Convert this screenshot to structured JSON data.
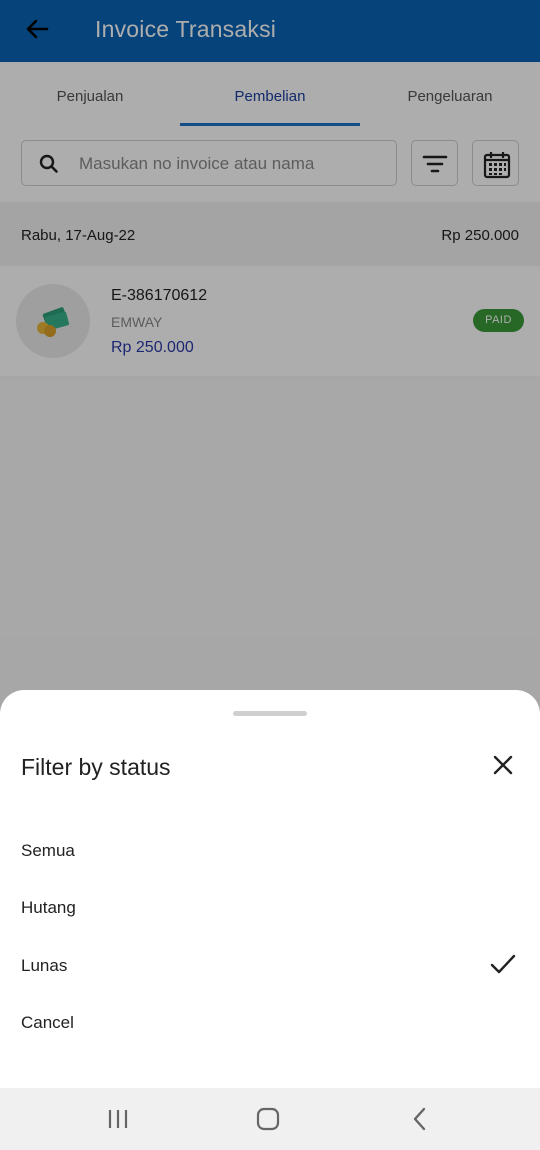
{
  "appbar": {
    "title": "Invoice Transaksi",
    "back_icon": "arrow-left-icon"
  },
  "tabs": [
    {
      "label": "Penjualan"
    },
    {
      "label": "Pembelian",
      "active": true
    },
    {
      "label": "Pengeluaran"
    }
  ],
  "search": {
    "placeholder": "Masukan no invoice atau nama",
    "icon": "search-icon"
  },
  "toolbar": {
    "filter_icon": "filter-icon",
    "calendar_icon": "calendar-icon"
  },
  "group": {
    "date": "Rabu, 17-Aug-22",
    "total": "Rp 250.000"
  },
  "items": [
    {
      "invoice_no": "E-386170612",
      "name": "EMWAY",
      "amount": "Rp 250.000",
      "status": "PAID",
      "icon": "money-icon"
    }
  ],
  "sheet": {
    "title": "Filter by status",
    "options": [
      {
        "label": "Semua"
      },
      {
        "label": "Hutang"
      },
      {
        "label": "Lunas",
        "selected": true
      },
      {
        "label": "Cancel"
      }
    ]
  },
  "colors": {
    "primary": "#0a63b5",
    "active_tab_text": "#1a3f9e",
    "amount": "#2a3aa8",
    "paid_badge": "#3a9a3a"
  }
}
